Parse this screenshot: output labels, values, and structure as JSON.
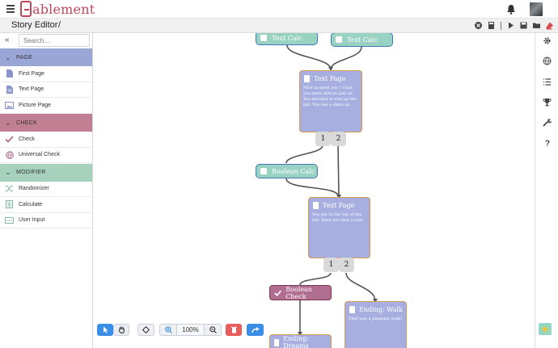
{
  "app": {
    "logo_text": "ablement"
  },
  "titlebar": {
    "title": "Story Editor",
    "separator": "/"
  },
  "sidebar": {
    "search_placeholder": "Search...",
    "sections": [
      {
        "label": "PAGE",
        "items": [
          "First Page",
          "Text Page",
          "Picture Page"
        ]
      },
      {
        "label": "CHECK",
        "items": [
          "Check",
          "Universal Check"
        ]
      },
      {
        "label": "MODIFIER",
        "items": [
          "Randomizer",
          "Calculate",
          "User Input"
        ]
      }
    ]
  },
  "canvas": {
    "calc1": "Text Calc",
    "calc2": "Text Calc",
    "page1": {
      "title": "Text Page",
      "body": "Nice to meet you ! Glad you were able to join us. You decided to run up the hill. You see a shiny sp..."
    },
    "page1_outs": [
      "1",
      "2"
    ],
    "calc3": "Boolean Calc",
    "page2": {
      "title": "Text Page",
      "body": "You get to the top of the hill. Here you find a well."
    },
    "page2_outs": [
      "1",
      "2"
    ],
    "check1": "Boolean Check",
    "ending_walk": {
      "title": "Ending: Walk",
      "body": "That was a pleasant walk!"
    },
    "ending_dreams": {
      "title": "Ending: Dreams"
    }
  },
  "toolbar": {
    "zoom": "100%"
  },
  "colors": {
    "page_node": "#a6afe0",
    "calc_node": "#9ad2c1",
    "check_node": "#b16d8f",
    "accent_blue": "#3a8ee6",
    "delete_red": "#e85c5c",
    "brand": "#c0475a"
  }
}
